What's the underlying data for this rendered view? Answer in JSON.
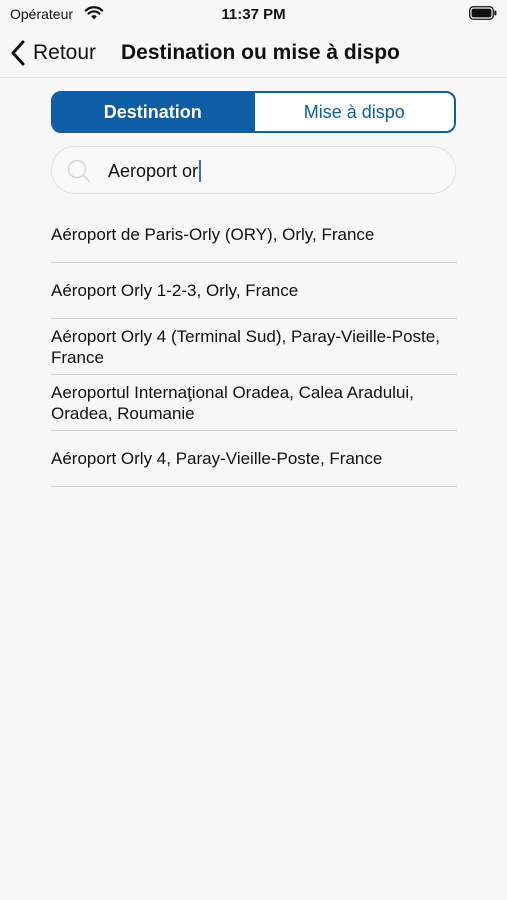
{
  "status_bar": {
    "carrier": "Opérateur",
    "time": "11:37 PM"
  },
  "nav": {
    "back_label": "Retour",
    "title": "Destination ou mise à dispo"
  },
  "tabs": [
    {
      "label": "Destination",
      "active": true
    },
    {
      "label": "Mise à dispo",
      "active": false
    }
  ],
  "search": {
    "value": "Aeroport or"
  },
  "results": [
    {
      "label": "Aéroport de Paris-Orly (ORY), Orly, France"
    },
    {
      "label": "Aéroport Orly 1-2-3, Orly, France"
    },
    {
      "label": "Aéroport Orly 4 (Terminal Sud), Paray-Vieille-Poste, France"
    },
    {
      "label": "Aeroportul Internaţional Oradea, Calea Aradului, Oradea, Roumanie"
    },
    {
      "label": "Aéroport Orly 4, Paray-Vieille-Poste, France"
    }
  ],
  "colors": {
    "accent": "#0d5ea7",
    "background": "#f7f7f7",
    "caret": "#2f6fd6"
  }
}
